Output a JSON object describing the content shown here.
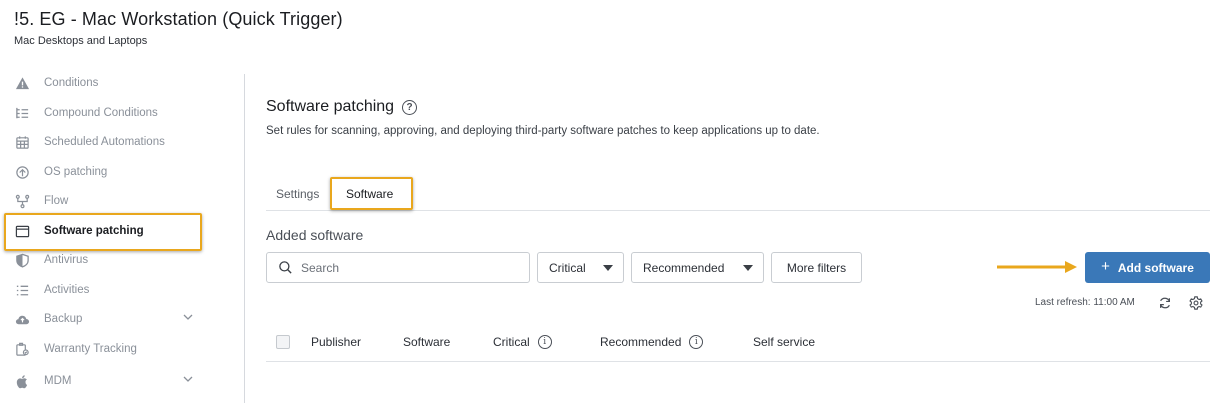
{
  "header": {
    "title": "!5. EG - Mac Workstation (Quick Trigger)",
    "subtitle": "Mac Desktops and Laptops"
  },
  "sidebar": {
    "items": [
      {
        "label": "Conditions",
        "icon": "warning-icon"
      },
      {
        "label": "Compound Conditions",
        "icon": "list-tree-icon"
      },
      {
        "label": "Scheduled Automations",
        "icon": "calendar-icon"
      },
      {
        "label": "OS patching",
        "icon": "patch-icon"
      },
      {
        "label": "Flow",
        "icon": "flow-icon"
      },
      {
        "label": "Software patching",
        "icon": "window-icon",
        "active": true
      },
      {
        "label": "Antivirus",
        "icon": "shield-icon"
      },
      {
        "label": "Activities",
        "icon": "list-icon"
      },
      {
        "label": "Backup",
        "icon": "cloud-icon",
        "expandable": true
      },
      {
        "label": "Warranty Tracking",
        "icon": "warranty-icon"
      },
      {
        "label": "MDM",
        "icon": "apple-icon",
        "expandable": true
      }
    ]
  },
  "main": {
    "title": "Software patching",
    "description": "Set rules for scanning, approving, and deploying third-party software patches to keep applications up to date.",
    "tabs": [
      {
        "label": "Settings",
        "active": false
      },
      {
        "label": "Software",
        "active": true
      }
    ],
    "added_title": "Added software",
    "search_placeholder": "Search",
    "filters": {
      "critical": "Critical",
      "recommended": "Recommended",
      "more": "More filters"
    },
    "add_button": "Add software",
    "last_refresh": "Last refresh: 11:00 AM",
    "columns": [
      "Publisher",
      "Software",
      "Critical",
      "Recommended",
      "Self service"
    ]
  },
  "colors": {
    "accent": "#3a78b8",
    "highlight": "#e9a71d"
  }
}
